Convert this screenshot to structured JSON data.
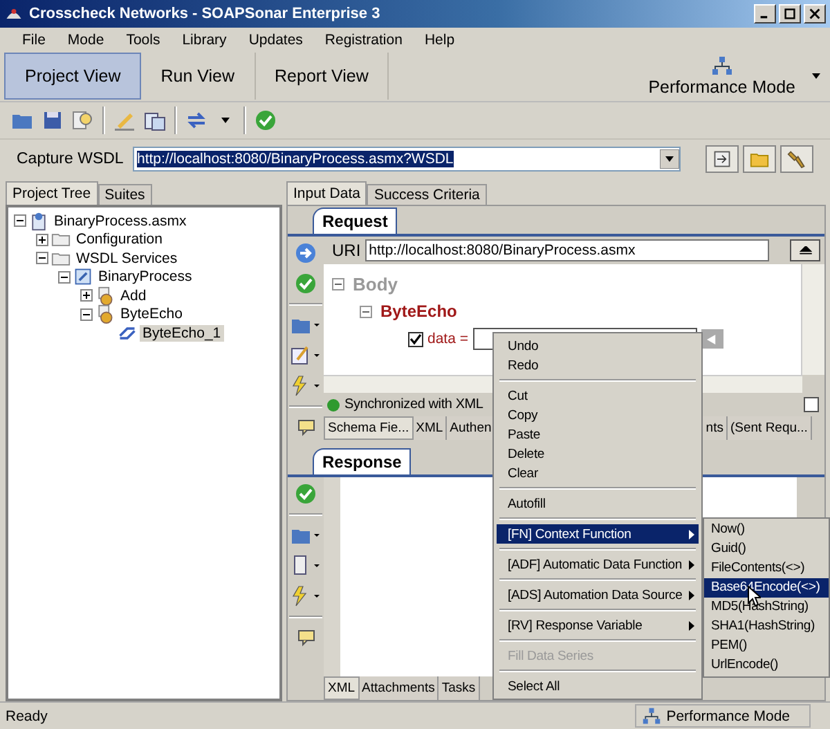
{
  "window": {
    "title": "Crosscheck Networks - SOAPSonar Enterprise 3"
  },
  "menu": [
    "File",
    "Mode",
    "Tools",
    "Library",
    "Updates",
    "Registration",
    "Help"
  ],
  "view_tabs": [
    {
      "label": "Project View",
      "selected": true
    },
    {
      "label": "Run View",
      "selected": false
    },
    {
      "label": "Report View",
      "selected": false
    }
  ],
  "mode_button": {
    "label": "Performance Mode"
  },
  "capture": {
    "label": "Capture WSDL",
    "value": "http://localhost:8080/BinaryProcess.asmx?WSDL"
  },
  "left_tabs": [
    {
      "label": "Project Tree",
      "selected": true
    },
    {
      "label": "Suites",
      "selected": false
    }
  ],
  "tree": [
    {
      "label": "BinaryProcess.asmx",
      "kind": "file",
      "expanded": true,
      "selected": false,
      "children": [
        {
          "label": "Configuration",
          "kind": "folder",
          "expanded": false,
          "selected": false
        },
        {
          "label": "WSDL Services",
          "kind": "folder",
          "expanded": true,
          "selected": false,
          "children": [
            {
              "label": "BinaryProcess",
              "kind": "service",
              "expanded": true,
              "selected": false,
              "children": [
                {
                  "label": "Add",
                  "kind": "operation",
                  "expanded": false,
                  "selected": false
                },
                {
                  "label": "ByteEcho",
                  "kind": "operation",
                  "expanded": true,
                  "selected": false,
                  "children": [
                    {
                      "label": "ByteEcho_1",
                      "kind": "request",
                      "selected": true
                    }
                  ]
                }
              ]
            }
          ]
        }
      ]
    }
  ],
  "right_tabs": [
    {
      "label": "Input Data",
      "selected": true
    },
    {
      "label": "Success Criteria",
      "selected": false
    }
  ],
  "request": {
    "tab": "Request",
    "uri_label": "URI",
    "uri": "http://localhost:8080/BinaryProcess.asmx",
    "body": "Body",
    "operation": "ByteEcho",
    "field": {
      "label": "data =",
      "checked": true
    },
    "sync": "Synchronized with XML",
    "sync_checked": false
  },
  "request_subtabs": [
    {
      "label": "Schema Fie...",
      "selected": true
    },
    {
      "label": "XML",
      "selected": false
    },
    {
      "label": "Authen",
      "selected": false
    },
    {
      "label": "nts",
      "selected": false
    },
    {
      "label": "(Sent Requ...",
      "selected": false
    }
  ],
  "response": {
    "tab": "Response"
  },
  "response_subtabs": [
    {
      "label": "XML",
      "selected": true
    },
    {
      "label": "Attachments",
      "selected": false
    },
    {
      "label": "Tasks",
      "selected": false
    }
  ],
  "context_menu": [
    [
      {
        "label": "Undo",
        "disabled": false,
        "submenu": false,
        "selected": false
      },
      {
        "label": "Redo",
        "disabled": false,
        "submenu": false,
        "selected": false
      }
    ],
    [
      {
        "label": "Cut",
        "disabled": false,
        "submenu": false,
        "selected": false
      },
      {
        "label": "Copy",
        "disabled": false,
        "submenu": false,
        "selected": false
      },
      {
        "label": "Paste",
        "disabled": false,
        "submenu": false,
        "selected": false
      },
      {
        "label": "Delete",
        "disabled": false,
        "submenu": false,
        "selected": false
      },
      {
        "label": "Clear",
        "disabled": false,
        "submenu": false,
        "selected": false
      }
    ],
    [
      {
        "label": "Autofill",
        "disabled": false,
        "submenu": false,
        "selected": false
      }
    ],
    [
      {
        "label": "[FN] Context Function",
        "disabled": false,
        "submenu": true,
        "selected": true
      }
    ],
    [
      {
        "label": "[ADF] Automatic Data Function",
        "disabled": false,
        "submenu": true,
        "selected": false
      }
    ],
    [
      {
        "label": "[ADS] Automation Data Source",
        "disabled": false,
        "submenu": true,
        "selected": false
      }
    ],
    [
      {
        "label": "[RV] Response Variable",
        "disabled": false,
        "submenu": true,
        "selected": false
      }
    ],
    [
      {
        "label": "Fill Data Series",
        "disabled": true,
        "submenu": false,
        "selected": false
      }
    ],
    [
      {
        "label": "Select All",
        "disabled": false,
        "submenu": false,
        "selected": false
      }
    ]
  ],
  "submenu": [
    {
      "label": "Now()",
      "selected": false
    },
    {
      "label": "Guid()",
      "selected": false
    },
    {
      "label": "FileContents(<>)",
      "selected": false
    },
    {
      "label": "Base64Encode(<>)",
      "selected": true
    },
    {
      "label": "MD5(HashString)",
      "selected": false
    },
    {
      "label": "SHA1(HashString)",
      "selected": false
    },
    {
      "label": "PEM()",
      "selected": false
    },
    {
      "label": "UrlEncode()",
      "selected": false
    }
  ],
  "status_bar": {
    "text": "Ready",
    "mode": "Performance Mode"
  }
}
